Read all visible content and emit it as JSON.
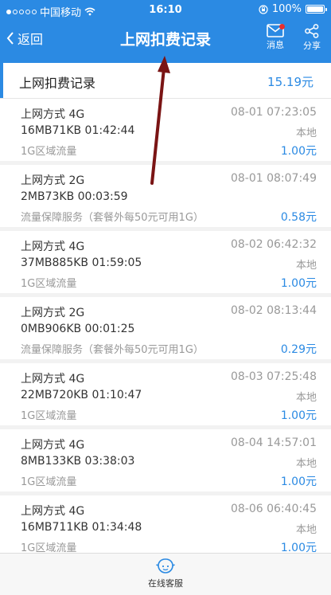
{
  "status_bar": {
    "carrier": "中国移动",
    "time": "16:10",
    "battery": "100%"
  },
  "nav": {
    "back_label": "返回",
    "title": "上网扣费记录",
    "message_label": "消息",
    "share_label": "分享"
  },
  "summary": {
    "label": "上网扣费记录",
    "amount": "15.19元"
  },
  "records": [
    {
      "method": "上网方式 4G",
      "usage": "16MB71KB 01:42:44",
      "type": "1G区域流量",
      "datetime": "08-01 07:23:05",
      "location": "本地",
      "cost": "1.00元"
    },
    {
      "method": "上网方式 2G",
      "usage": "2MB73KB 00:03:59",
      "type": "流量保障服务（套餐外每50元可用1G）",
      "datetime": "08-01 08:07:49",
      "location": "",
      "cost": "0.58元"
    },
    {
      "method": "上网方式 4G",
      "usage": "37MB885KB 01:59:05",
      "type": "1G区域流量",
      "datetime": "08-02 06:42:32",
      "location": "本地",
      "cost": "1.00元"
    },
    {
      "method": "上网方式 2G",
      "usage": "0MB906KB 00:01:25",
      "type": "流量保障服务（套餐外每50元可用1G）",
      "datetime": "08-02 08:13:44",
      "location": "",
      "cost": "0.29元"
    },
    {
      "method": "上网方式 4G",
      "usage": "22MB720KB 01:10:47",
      "type": "1G区域流量",
      "datetime": "08-03 07:25:48",
      "location": "本地",
      "cost": "1.00元"
    },
    {
      "method": "上网方式 4G",
      "usage": "8MB133KB 03:38:03",
      "type": "1G区域流量",
      "datetime": "08-04 14:57:01",
      "location": "本地",
      "cost": "1.00元"
    },
    {
      "method": "上网方式 4G",
      "usage": "16MB711KB 01:34:48",
      "type": "1G区域流量",
      "datetime": "08-06 06:40:45",
      "location": "本地",
      "cost": "1.00元"
    }
  ],
  "bottom_bar": {
    "service_label": "在线客服"
  },
  "colors": {
    "header": "#2b8ae3",
    "accent_text": "#2b8ae3",
    "annotation_arrow": "#7a1414"
  }
}
